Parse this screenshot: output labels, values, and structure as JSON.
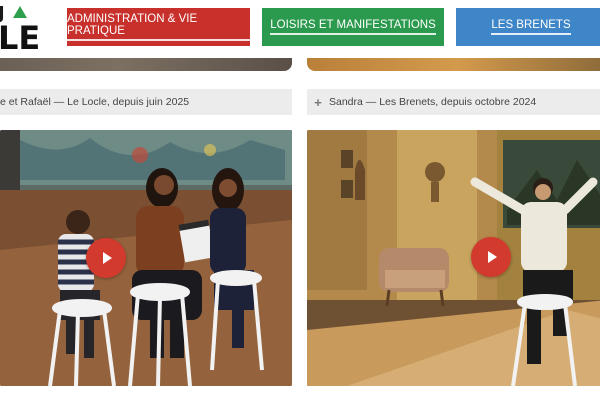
{
  "logo": {
    "top_text": "J",
    "main_text": "LE"
  },
  "nav": {
    "admin": "ADMINISTRATION & VIE PRATIQUE",
    "loisirs": "LOISIRS ET MANIFESTATIONS",
    "brenets": "LES BRENETS"
  },
  "videos": [
    {
      "caption": "e et Rafaël — Le Locle, depuis juin 2025",
      "play_icon": "play-icon"
    },
    {
      "caption": "Sandra — Les Brenets, depuis octobre 2024",
      "plus": "+",
      "play_icon": "play-icon"
    }
  ],
  "colors": {
    "red": "#c8302c",
    "green": "#2c9a4e",
    "blue": "#3f86c8",
    "play": "#d23a2e"
  }
}
